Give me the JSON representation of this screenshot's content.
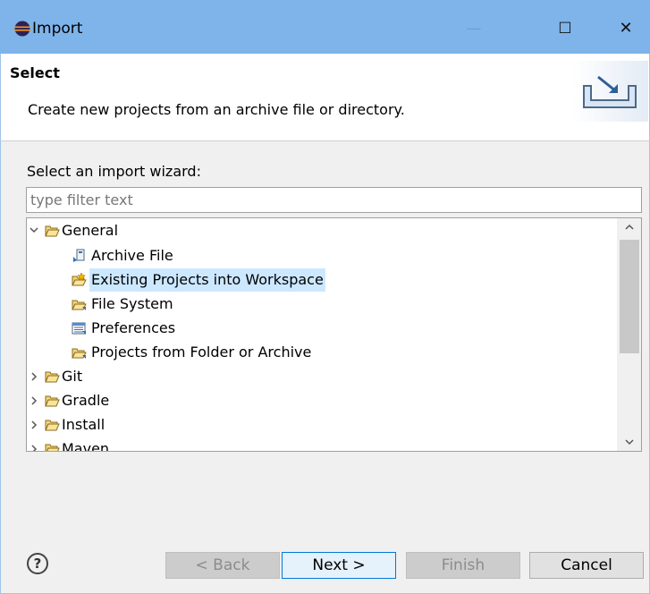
{
  "window": {
    "title": "Import",
    "minimize": "—",
    "maximize": "☐",
    "close": "✕"
  },
  "header": {
    "title": "Select",
    "description": "Create new projects from an archive file or directory."
  },
  "wizard": {
    "label": "Select an import wizard:",
    "filter_placeholder": "type filter text",
    "filter_value": ""
  },
  "tree": {
    "items": [
      {
        "label": "General",
        "expanded": true,
        "icon": "open-folder-icon"
      },
      {
        "label": "Archive File",
        "icon": "archive-file-icon"
      },
      {
        "label": "Existing Projects into Workspace",
        "icon": "existing-projects-icon",
        "selected": true
      },
      {
        "label": "File System",
        "icon": "file-system-icon"
      },
      {
        "label": "Preferences",
        "icon": "preferences-icon"
      },
      {
        "label": "Projects from Folder or Archive",
        "icon": "projects-folder-icon"
      },
      {
        "label": "Git",
        "expanded": false,
        "icon": "open-folder-icon"
      },
      {
        "label": "Gradle",
        "expanded": false,
        "icon": "open-folder-icon"
      },
      {
        "label": "Install",
        "expanded": false,
        "icon": "open-folder-icon"
      },
      {
        "label": "Maven",
        "expanded": false,
        "icon": "open-folder-icon"
      }
    ]
  },
  "buttons": {
    "help": "?",
    "back": "< Back",
    "next": "Next >",
    "finish": "Finish",
    "cancel": "Cancel"
  },
  "colors": {
    "titlebar": "#7eb4ea",
    "selection": "#cce8ff",
    "default_button_border": "#0078d7"
  }
}
